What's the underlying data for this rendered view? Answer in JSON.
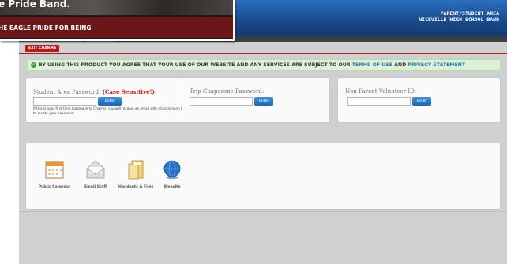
{
  "header": {
    "title_line1": "PARENT/STUDENT AREA",
    "title_line2": "NICEVILLE HIGH SCHOOL BAND"
  },
  "toolbar": {
    "exit_label": "EXIT CHARMS"
  },
  "notice": {
    "text_before": "BY USING THIS PRODUCT YOU AGREE THAT YOUR USE OF OUR WEBSITE AND ANY SERVICES ARE SUBJECT TO OUR ",
    "terms_link": "TERMS OF USE",
    "and": " AND ",
    "privacy_link": "PRIVACY STATEMENT"
  },
  "login": {
    "student": {
      "label": "Student Area Password:",
      "case_note": "(Case Sensitive!)",
      "button": "Enter",
      "note": "If this is your first time logging in to Charms, you will receive an email with directions on how to create your password."
    },
    "chaperone": {
      "label": "Trip Chaperone Password:",
      "button": "Enter"
    },
    "volunteer": {
      "label": "Non-Parent Volunteer ID:",
      "button": "Enter"
    }
  },
  "apps": [
    {
      "label": "Public Calendar",
      "icon": "calendar-icon"
    },
    {
      "label": "Email Staff",
      "icon": "envelope-icon"
    },
    {
      "label": "Handouts & Files",
      "icon": "folder-icon"
    },
    {
      "label": "Website",
      "icon": "globe-icon"
    }
  ],
  "popup": {
    "heading": "e Pride Band.",
    "tagline": "HE EAGLE PRIDE FOR BEING"
  },
  "colors": {
    "accent_red": "#b01e1e",
    "header_blue": "#1a4c8f",
    "notice_green": "#dff0d8"
  }
}
